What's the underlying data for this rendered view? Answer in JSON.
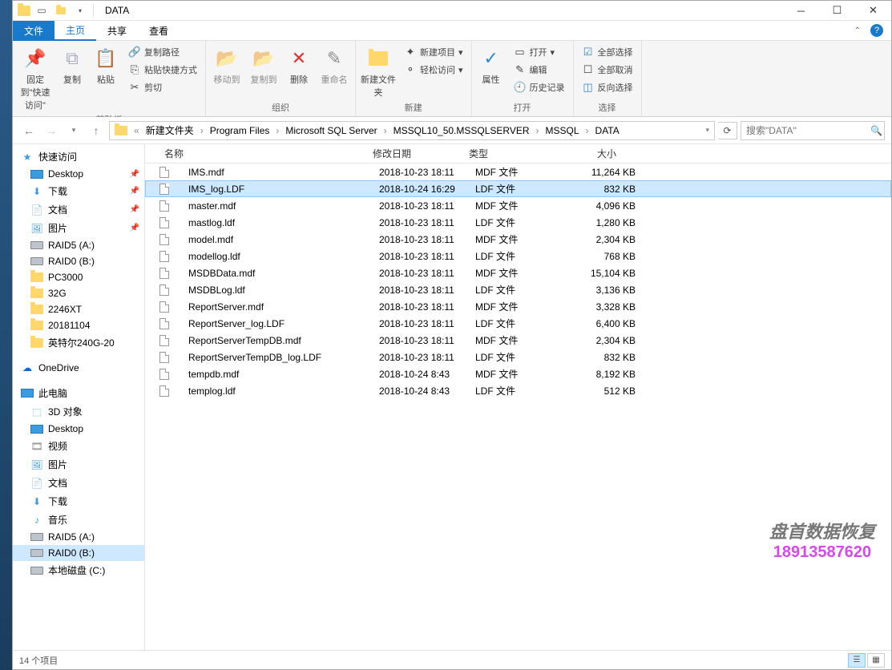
{
  "title": "DATA",
  "tabs": {
    "file": "文件",
    "home": "主页",
    "share": "共享",
    "view": "查看"
  },
  "ribbon": {
    "pin": "固定到\"快速访问\"",
    "copy": "复制",
    "paste": "粘贴",
    "copypath": "复制路径",
    "pasteshortcut": "粘贴快捷方式",
    "cut": "剪切",
    "clipboard": "剪贴板",
    "moveto": "移动到",
    "copyto": "复制到",
    "delete": "删除",
    "rename": "重命名",
    "organize": "组织",
    "newfolder": "新建文件夹",
    "newitem": "新建项目",
    "easyaccess": "轻松访问",
    "new": "新建",
    "properties": "属性",
    "open": "打开",
    "edit": "编辑",
    "history": "历史记录",
    "opengrp": "打开",
    "selectall": "全部选择",
    "selectnone": "全部取消",
    "invertsel": "反向选择",
    "select": "选择"
  },
  "breadcrumb": [
    "新建文件夹",
    "Program Files",
    "Microsoft SQL Server",
    "MSSQL10_50.MSSQLSERVER",
    "MSSQL",
    "DATA"
  ],
  "search_placeholder": "搜索\"DATA\"",
  "columns": {
    "name": "名称",
    "date": "修改日期",
    "type": "类型",
    "size": "大小"
  },
  "nav": {
    "quick": "快速访问",
    "desktop": "Desktop",
    "downloads": "下载",
    "documents": "文档",
    "pictures": "图片",
    "raid5": "RAID5 (A:)",
    "raid0": "RAID0 (B:)",
    "pc3000": "PC3000",
    "g32": "32G",
    "xt": "2246XT",
    "d20181104": "20181104",
    "intel": "英特尔240G-20",
    "onedrive": "OneDrive",
    "thispc": "此电脑",
    "obj3d": "3D 对象",
    "desktop2": "Desktop",
    "videos": "视频",
    "pictures2": "图片",
    "documents2": "文档",
    "downloads2": "下载",
    "music": "音乐",
    "raid5b": "RAID5 (A:)",
    "raid0b": "RAID0 (B:)",
    "localc": "本地磁盘 (C:)"
  },
  "files": [
    {
      "name": "IMS.mdf",
      "date": "2018-10-23 18:11",
      "type": "MDF 文件",
      "size": "11,264 KB",
      "sel": false
    },
    {
      "name": "IMS_log.LDF",
      "date": "2018-10-24 16:29",
      "type": "LDF 文件",
      "size": "832 KB",
      "sel": true
    },
    {
      "name": "master.mdf",
      "date": "2018-10-23 18:11",
      "type": "MDF 文件",
      "size": "4,096 KB",
      "sel": false
    },
    {
      "name": "mastlog.ldf",
      "date": "2018-10-23 18:11",
      "type": "LDF 文件",
      "size": "1,280 KB",
      "sel": false
    },
    {
      "name": "model.mdf",
      "date": "2018-10-23 18:11",
      "type": "MDF 文件",
      "size": "2,304 KB",
      "sel": false
    },
    {
      "name": "modellog.ldf",
      "date": "2018-10-23 18:11",
      "type": "LDF 文件",
      "size": "768 KB",
      "sel": false
    },
    {
      "name": "MSDBData.mdf",
      "date": "2018-10-23 18:11",
      "type": "MDF 文件",
      "size": "15,104 KB",
      "sel": false
    },
    {
      "name": "MSDBLog.ldf",
      "date": "2018-10-23 18:11",
      "type": "LDF 文件",
      "size": "3,136 KB",
      "sel": false
    },
    {
      "name": "ReportServer.mdf",
      "date": "2018-10-23 18:11",
      "type": "MDF 文件",
      "size": "3,328 KB",
      "sel": false
    },
    {
      "name": "ReportServer_log.LDF",
      "date": "2018-10-23 18:11",
      "type": "LDF 文件",
      "size": "6,400 KB",
      "sel": false
    },
    {
      "name": "ReportServerTempDB.mdf",
      "date": "2018-10-23 18:11",
      "type": "MDF 文件",
      "size": "2,304 KB",
      "sel": false
    },
    {
      "name": "ReportServerTempDB_log.LDF",
      "date": "2018-10-23 18:11",
      "type": "LDF 文件",
      "size": "832 KB",
      "sel": false
    },
    {
      "name": "tempdb.mdf",
      "date": "2018-10-24 8:43",
      "type": "MDF 文件",
      "size": "8,192 KB",
      "sel": false
    },
    {
      "name": "templog.ldf",
      "date": "2018-10-24 8:43",
      "type": "LDF 文件",
      "size": "512 KB",
      "sel": false
    }
  ],
  "status": "14 个项目",
  "watermark": {
    "line1": "盘首数据恢复",
    "line2": "18913587620"
  }
}
